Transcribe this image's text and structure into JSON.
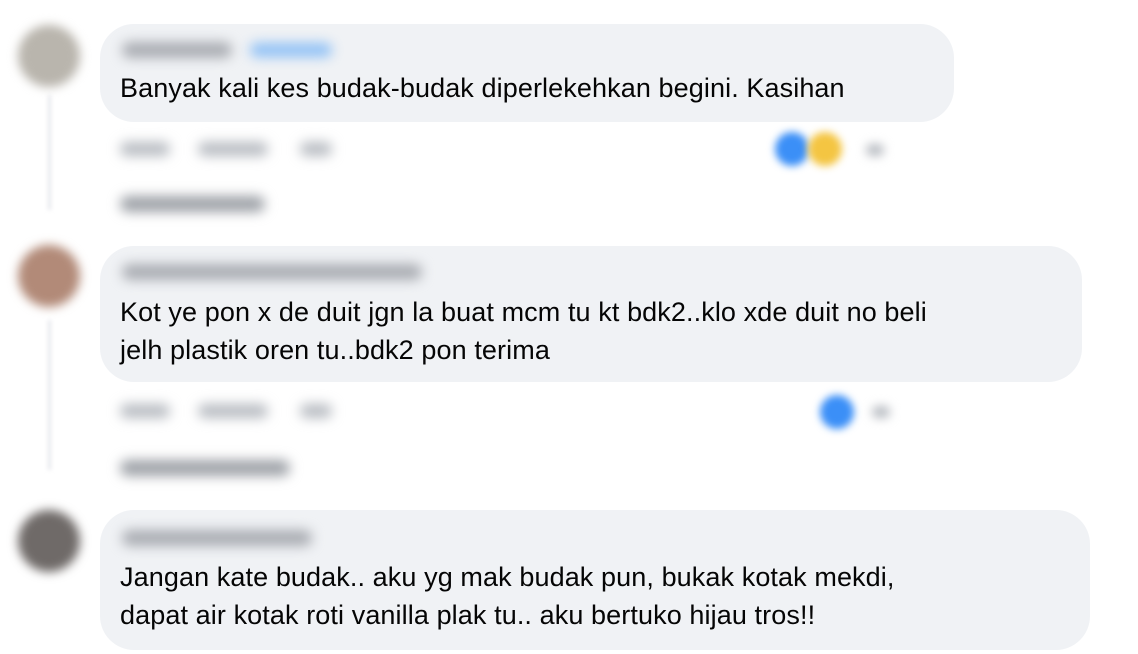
{
  "colors": {
    "bubble_bg": "#f0f2f5",
    "text": "#050505",
    "like_blue": "#3b8ff7",
    "haha_yellow": "#f4c542"
  },
  "comments": [
    {
      "avatar_color": "#b9b5ad",
      "text_lines": [
        "Banyak kali kes budak-budak diperlekehkan begini. Kasihan"
      ],
      "reactions": [
        "like",
        "haha"
      ]
    },
    {
      "avatar_color": "#b28a78",
      "text_lines": [
        "Kot ye pon x de duit jgn la buat mcm tu kt bdk2..klo xde duit no beli",
        "jelh plastik oren tu..bdk2 pon terima"
      ],
      "reactions": [
        "like"
      ]
    },
    {
      "avatar_color": "#6f6a68",
      "text_lines": [
        "Jangan kate budak.. aku yg mak budak pun, bukak kotak mekdi,",
        "dapat air kotak roti vanilla plak tu.. aku bertuko hijau tros!!"
      ],
      "reactions": []
    }
  ]
}
